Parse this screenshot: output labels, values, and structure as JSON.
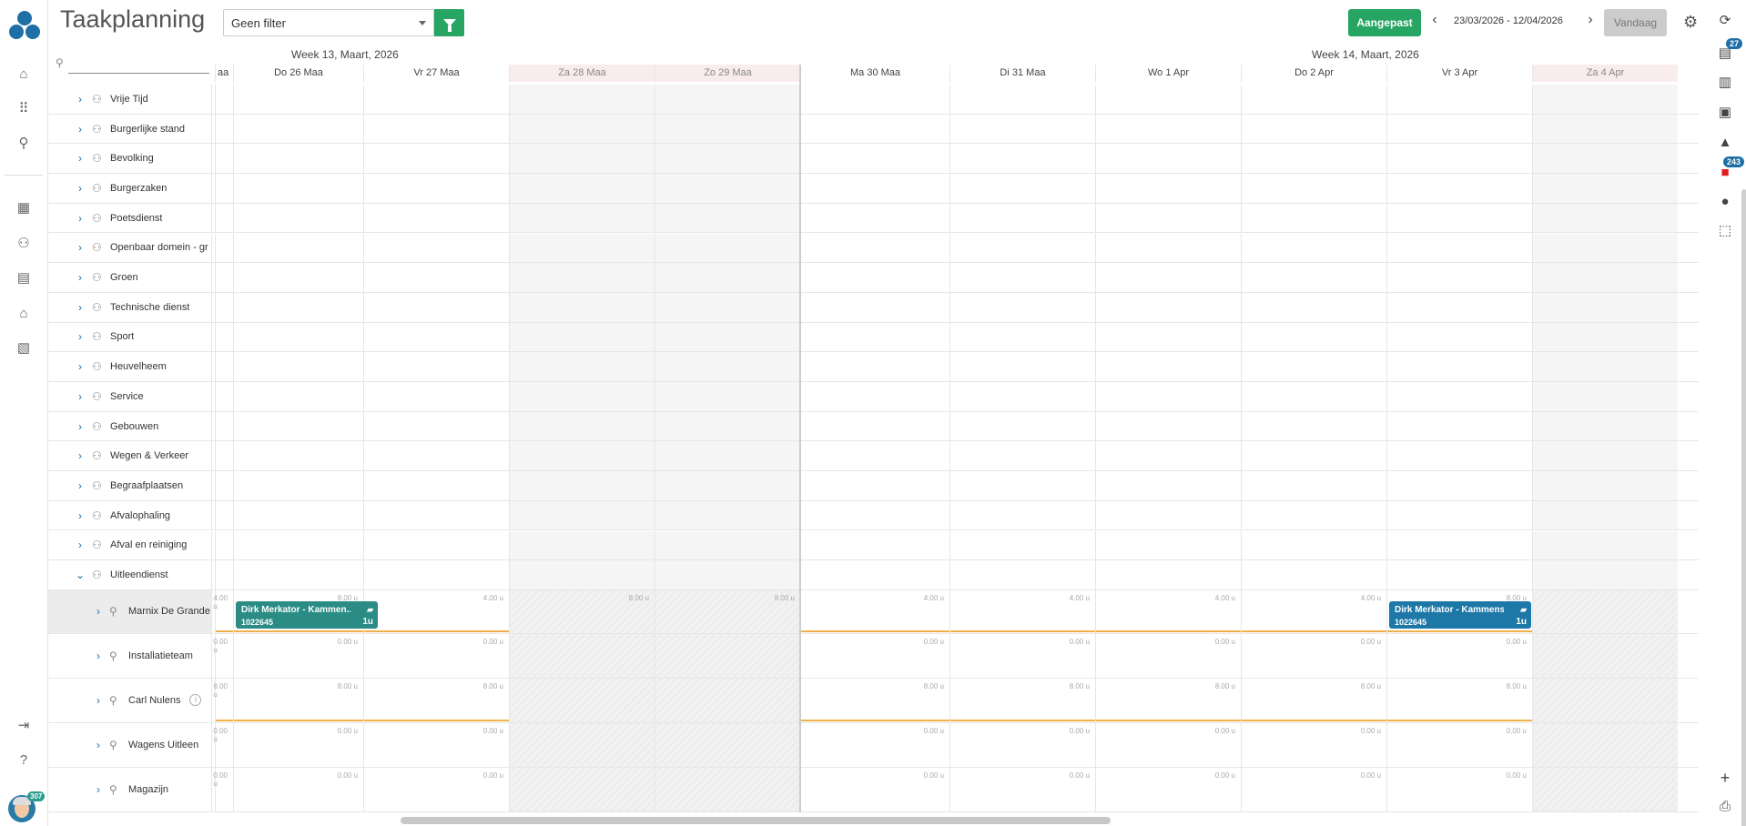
{
  "header": {
    "title": "Taakplanning",
    "filter_value": "Geen filter",
    "btn_aangepast": "Aangepast",
    "daterange": "23/03/2026 - 12/04/2026",
    "btn_vandaag": "Vandaag"
  },
  "rightbar": {
    "badge_doc": "27",
    "badge_red": "243"
  },
  "avatar_badge": "307",
  "timeline": {
    "weeks": [
      {
        "label": "Week 13, Maart, 2026"
      },
      {
        "label": "Week 14, Maart, 2026"
      }
    ],
    "days": [
      {
        "label": "aa",
        "weekend": false
      },
      {
        "label": "Do 26 Maa",
        "weekend": false
      },
      {
        "label": "Vr 27 Maa",
        "weekend": false
      },
      {
        "label": "Za 28 Maa",
        "weekend": true
      },
      {
        "label": "Zo 29 Maa",
        "weekend": true
      },
      {
        "label": "Ma 30 Maa",
        "weekend": false
      },
      {
        "label": "Di 31 Maa",
        "weekend": false
      },
      {
        "label": "Wo 1 Apr",
        "weekend": false
      },
      {
        "label": "Do 2 Apr",
        "weekend": false
      },
      {
        "label": "Vr 3 Apr",
        "weekend": false
      },
      {
        "label": "Za 4 Apr",
        "weekend": true
      }
    ]
  },
  "groups": [
    "Vrije Tijd",
    "Burgerlijke stand",
    "Bevolking",
    "Burgerzaken",
    "Poetsdienst",
    "Openbaar domein - gr",
    "Groen",
    "Technische dienst",
    "Sport",
    "Heuvelheem",
    "Service",
    "Gebouwen",
    "Wegen & Verkeer",
    "Begraafplaatsen",
    "Afvalophaling",
    "Afval en reiniging",
    "Uitleendienst"
  ],
  "resources": [
    {
      "name": "Marnix De Grande",
      "caps": [
        "4.00 u",
        "8.00 u",
        "4.00 u",
        "8.00 u",
        "8.00 u",
        "4.00 u",
        "4.00 u",
        "4.00 u",
        "4.00 u",
        "8.00 u"
      ],
      "bar": true,
      "selected": true
    },
    {
      "name": "Installatieteam",
      "caps": [
        "0.00 u",
        "0.00 u",
        "0.00 u",
        "",
        "",
        "0.00 u",
        "0.00 u",
        "0.00 u",
        "0.00 u",
        "0.00 u"
      ],
      "bar": false,
      "selected": false
    },
    {
      "name": "Carl Nulens",
      "caps": [
        "8.00 u",
        "8.00 u",
        "8.00 u",
        "",
        "",
        "8.00 u",
        "8.00 u",
        "8.00 u",
        "8.00 u",
        "8.00 u"
      ],
      "bar": true,
      "selected": false,
      "info": true
    },
    {
      "name": "Wagens Uitleen",
      "caps": [
        "0.00 u",
        "0.00 u",
        "0.00 u",
        "",
        "",
        "0.00 u",
        "0.00 u",
        "0.00 u",
        "0.00 u",
        "0.00 u"
      ],
      "bar": false,
      "selected": false
    },
    {
      "name": "Magazijn",
      "caps": [
        "0.00 u",
        "0.00 u",
        "0.00 u",
        "",
        "",
        "0.00 u",
        "0.00 u",
        "0.00 u",
        "0.00 u",
        "0.00 u"
      ],
      "bar": false,
      "selected": false
    }
  ],
  "tasks": [
    {
      "title": "Dirk Merkator - Kammen...",
      "code": "1022645",
      "hours": "1u",
      "color": "#2a8c84"
    },
    {
      "title": "Dirk Merkator - Kammenstr...",
      "code": "1022645",
      "hours": "1u",
      "color": "#1d78a8"
    }
  ]
}
